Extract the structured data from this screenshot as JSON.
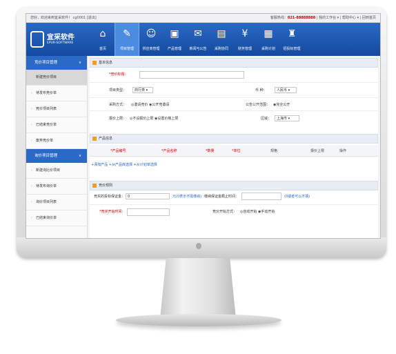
{
  "topbar": {
    "welcome": "您好，欢迎来到宜采软件！ cg0001 [退出]",
    "hotline": "客服热线：",
    "phone": "021-88888888",
    "links": "| 我的工作台 ▾ | 帮助中心 ▾ | 回到首页"
  },
  "brand": {
    "name": "宜采软件",
    "sub": "EPUR-SOFTWARE"
  },
  "nav": [
    {
      "label": "首页",
      "icon": "⌂"
    },
    {
      "label": "项目管理",
      "icon": "✎"
    },
    {
      "label": "供应商管理",
      "icon": "☺"
    },
    {
      "label": "产品管理",
      "icon": "▣"
    },
    {
      "label": "新闻与公告",
      "icon": "✉"
    },
    {
      "label": "采购协同",
      "icon": "▤"
    },
    {
      "label": "财务管理",
      "icon": "¥"
    },
    {
      "label": "采购计划",
      "icon": "▦"
    },
    {
      "label": "招投标管理",
      "icon": "♜"
    }
  ],
  "sidebar": {
    "group1": "竞价项目管理",
    "items1": [
      "新建竞价项目",
      "待发布竞价单",
      "竞价项目列表",
      "已结束竞价单",
      "废弃竞价单"
    ],
    "group2": "询价项目管理",
    "items2": [
      "新建询比价项目",
      "待发布询价单",
      "询价项目列表",
      "已结束询价单"
    ]
  },
  "basic": {
    "title": "基本信息",
    "bid_title_label": "*竞价标题：",
    "type_label": "项目类型：",
    "type_value": "商行类 ▾",
    "currency_label": "币 种：",
    "currency_value": "人民币 ▾",
    "method_label": "采购方式：",
    "method_value": "◎邀请竞价 ◉公开竞邀请",
    "publish_label": "公告公开范围：",
    "publish_value": "◉完全公开",
    "quote_label": "报价上限：",
    "quote_value": "◎不设报价上限 ◉设置价格上限",
    "region_label": "区域：",
    "region_value": "上海市 ▾"
  },
  "product": {
    "title": "产品信息",
    "columns": [
      "*产品编号",
      "*产品名称",
      "*数量",
      "*单位",
      "规格",
      "报价上限",
      "操作"
    ],
    "actions": "+添加产品 +从产品库选择 +从计划单选择"
  },
  "rules": {
    "title": "竞价规则",
    "deposit_label": "竞买的投标保证金：",
    "deposit_value": "0",
    "deposit_note": "元(0表示不需缴纳)",
    "deadline_label": "缴纳保证金截止时间：",
    "deadline_note": "(0或者可以不填)",
    "start_label": "*竞买开始时间：",
    "start_mode_label": "竞价开始方式：",
    "start_mode_value": "◎自动开始 ◉手动开始"
  }
}
